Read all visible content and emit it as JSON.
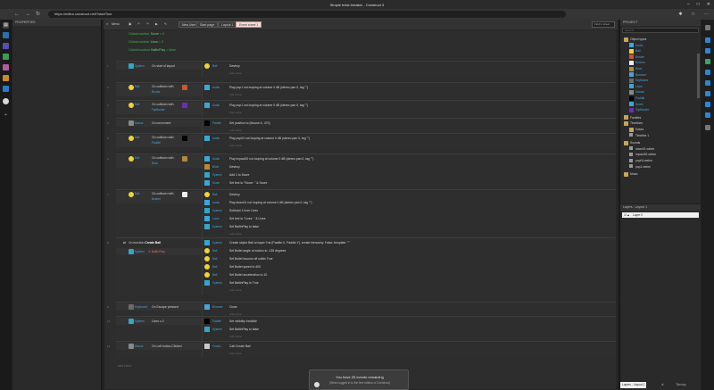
{
  "window": {
    "title": "Simple brick breaker - Construct 3"
  },
  "browser": {
    "url": "https://editor.construct.net/?startTour"
  },
  "menubar": {
    "menu_label": "Menu",
    "tabs": [
      "Start page",
      "Layout 1",
      "Event sheet 1"
    ],
    "tab_partial": "New User",
    "search_placeholder": "Find in sheet"
  },
  "panels": {
    "properties": "PROPERTIES",
    "project": "PROJECT",
    "project_search": "Search",
    "layers": "Layers - Layout 1"
  },
  "global_vars": [
    {
      "prefix": "Global number",
      "name": "Score",
      "value": "= 0"
    },
    {
      "prefix": "Global number",
      "name": "Lives",
      "value": "= 3"
    },
    {
      "prefix": "Global boolean",
      "name": "BallInPlay",
      "value": "= false"
    }
  ],
  "events": [
    {
      "num": "1",
      "cond_obj": "System",
      "cond": "On start of layout",
      "actions": [
        {
          "obj": "Ball",
          "text": "Destroy"
        }
      ]
    },
    {
      "num": "2",
      "cond_obj": "Ball",
      "cond": "On collision with",
      "cond_target": "Border",
      "actions": [
        {
          "obj": "Audio",
          "text": "Play pop1 not looping at volume 0 dB (stereo pan 0, tag \"\")"
        }
      ]
    },
    {
      "num": "3",
      "cond_obj": "Ball",
      "cond": "On collision with",
      "cond_target": "TopBorder",
      "actions": [
        {
          "obj": "Audio",
          "text": "Play pop1 not looping at volume 0 dB (stereo pan 0, tag \"\")"
        }
      ]
    },
    {
      "num": "4",
      "cond_obj": "Mouse",
      "cond": "On movement",
      "actions": [
        {
          "obj": "Paddle",
          "text": "Set position to (Mouse.X, 470)"
        }
      ]
    },
    {
      "num": "5",
      "cond_obj": "Ball",
      "cond": "On collision with",
      "cond_target": "Paddle",
      "actions": [
        {
          "obj": "Audio",
          "text": "Play pop04 not looping at volume 0 dB (stereo pan 0, tag \"\")"
        }
      ]
    },
    {
      "num": "6",
      "cond_obj": "Ball",
      "cond": "On collision with",
      "cond_target": "Brick",
      "actions": [
        {
          "obj": "Audio",
          "text": "Play impact02 not looping at volume 0 dB (stereo pan 0, tag \"\")"
        },
        {
          "obj": "Brick",
          "text": "Destroy"
        },
        {
          "obj": "System",
          "text": "Add 1 to Score"
        },
        {
          "obj": "Score",
          "text": "Set text to \"Score: \" & Score"
        }
      ]
    },
    {
      "num": "7",
      "cond_obj": "Ball",
      "cond": "On collision with",
      "cond_target": "Bottom",
      "actions": [
        {
          "obj": "Ball",
          "text": "Destroy"
        },
        {
          "obj": "Audio",
          "text": "Play down01 not looping at volume 0 dB (stereo pan 0, tag \"\")"
        },
        {
          "obj": "System",
          "text": "Subtract 1 from Lives"
        },
        {
          "obj": "Lives",
          "text": "Set text to \"Lives: \" & Lives"
        },
        {
          "obj": "System",
          "text": "Set BallInPlay to false"
        }
      ]
    },
    {
      "num": "8",
      "func": "On function",
      "func_name": "Create Ball",
      "cond_obj": "System",
      "cond": "BallInPlay",
      "actions": [
        {
          "obj": "System",
          "text": "Create object Ball on layer 0 at (Paddle.X, Paddle.Y), create hierarchy: False, template: \"\""
        },
        {
          "obj": "Ball",
          "text": "Set Bullet angle of motion to -135 degrees"
        },
        {
          "obj": "Ball",
          "text": "Set Bullet bounce off solids True"
        },
        {
          "obj": "Ball",
          "text": "Set Bullet speed to 400"
        },
        {
          "obj": "Ball",
          "text": "Set Bullet acceleration to 10"
        },
        {
          "obj": "System",
          "text": "Set BallInPlay to True"
        }
      ]
    },
    {
      "num": "9",
      "cond_obj": "Keyboard",
      "cond": "On Escape pressed",
      "actions": [
        {
          "obj": "Browser",
          "text": "Close"
        }
      ]
    },
    {
      "num": "10",
      "cond_obj": "System",
      "cond": "Lives ≤ 0",
      "actions": [
        {
          "obj": "Paddle",
          "text": "Set visibility Invisible"
        },
        {
          "obj": "System",
          "text": "Set BallInPlay to false"
        }
      ]
    },
    {
      "num": "11",
      "cond_obj": "Mouse",
      "cond": "On Left button Clicked",
      "actions": [
        {
          "obj": "Functi...",
          "text": "Call Create Ball"
        }
      ]
    }
  ],
  "add_action": "Add action",
  "add_event": "Add event",
  "notice": {
    "title": "You have 25 events remaining",
    "subtitle": "(When logged in to the free edition of Construct)"
  },
  "project_tree": [
    {
      "label": "Object types",
      "kind": "folder",
      "indent": 0
    },
    {
      "label": "Audio",
      "kind": "obj",
      "indent": 1,
      "color": "#3aa7d8"
    },
    {
      "label": "Ball",
      "kind": "obj",
      "indent": 1,
      "color": "#f1d23c"
    },
    {
      "label": "Border",
      "kind": "obj",
      "indent": 1,
      "color": "#d0542a"
    },
    {
      "label": "Bottom",
      "kind": "obj",
      "indent": 1,
      "color": "#f0f0f0"
    },
    {
      "label": "Brick",
      "kind": "obj",
      "indent": 1,
      "color": "#b48a3a"
    },
    {
      "label": "Browser",
      "kind": "obj",
      "indent": 1,
      "color": "#4aa3d8"
    },
    {
      "label": "Keyboard",
      "kind": "obj",
      "indent": 1,
      "color": "#6a6a6a"
    },
    {
      "label": "Lives",
      "kind": "obj",
      "indent": 1,
      "color": "#3aa7d8"
    },
    {
      "label": "Mouse",
      "kind": "obj",
      "indent": 1,
      "color": "#888888"
    },
    {
      "label": "Paddle",
      "kind": "obj",
      "indent": 1,
      "color": "#000000"
    },
    {
      "label": "Score",
      "kind": "obj",
      "indent": 1,
      "color": "#3aa7d8"
    },
    {
      "label": "TopBorder",
      "kind": "obj",
      "indent": 1,
      "color": "#6a2fb5"
    },
    {
      "label": "Families",
      "kind": "folder",
      "indent": 0
    },
    {
      "label": "Timelines",
      "kind": "folder",
      "indent": 0
    },
    {
      "label": "Eases",
      "kind": "folder",
      "indent": 1
    },
    {
      "label": "Timeline 1",
      "kind": "item",
      "indent": 1
    },
    {
      "label": "Sounds",
      "kind": "folder",
      "indent": 0
    },
    {
      "label": "down01.webm",
      "kind": "item",
      "indent": 1
    },
    {
      "label": "impact02.webm",
      "kind": "item",
      "indent": 1
    },
    {
      "label": "pop04.webm",
      "kind": "item",
      "indent": 1
    },
    {
      "label": "pop1.webm",
      "kind": "item",
      "indent": 1
    },
    {
      "label": "Music",
      "kind": "folder",
      "indent": 0
    }
  ],
  "layers": {
    "layer0": "Layer 0",
    "tab1": "Layers - Layout 1",
    "tab2": "Tilemap"
  },
  "colors": {
    "accent_green": "#39b54a",
    "object_blue": "#4aa3d8",
    "active_tab": "#f1dede"
  }
}
